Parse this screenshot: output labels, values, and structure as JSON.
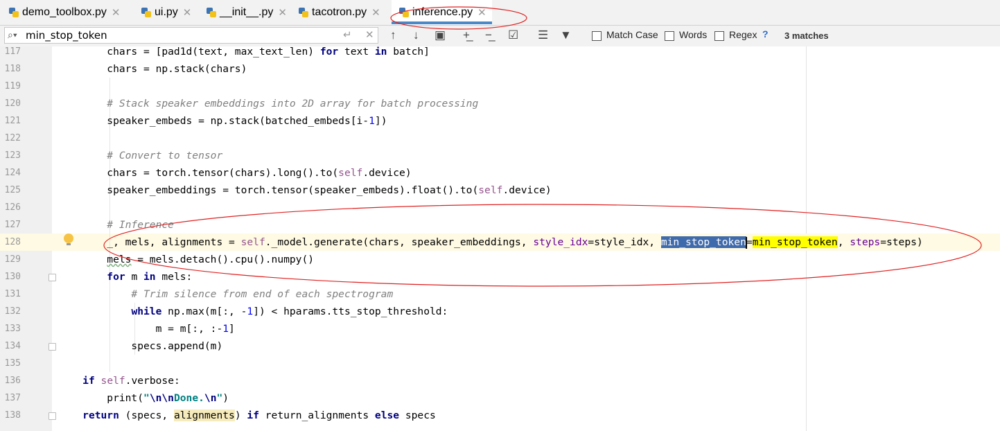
{
  "tabs": [
    {
      "label": "demo_toolbox.py",
      "active": false
    },
    {
      "label": "ui.py",
      "active": false
    },
    {
      "label": "__init__.py",
      "active": false
    },
    {
      "label": "tacotron.py",
      "active": false
    },
    {
      "label": "inference.py",
      "active": true
    }
  ],
  "search": {
    "value": "min_stop_token",
    "options": {
      "match_case": "Match Case",
      "words": "Words",
      "regex": "Regex"
    },
    "help": "?",
    "matches": "3 matches"
  },
  "icons": [
    "search-icon",
    "enter-icon",
    "clear-icon",
    "up-arrow-icon",
    "down-arrow-icon",
    "select-all-icon",
    "add-occurrence-icon",
    "remove-occurrence-icon",
    "select-all-occurrences-icon",
    "filter-lines-icon",
    "filter-icon",
    "bulb-icon"
  ],
  "colors": {
    "selection": "#3f6aab",
    "match": "#ffff00",
    "annotation": "#e02020",
    "tab_underline": "#4a88c7"
  },
  "editor": {
    "line_numbers": [
      "117",
      "118",
      "119",
      "120",
      "121",
      "122",
      "123",
      "124",
      "125",
      "126",
      "127",
      "128",
      "129",
      "130",
      "131",
      "132",
      "133",
      "134",
      "135",
      "136",
      "137",
      "138"
    ],
    "lines": [
      {
        "t": [
          [
            "        chars = [pad1d(text, max_text_len) ",
            ""
          ],
          [
            "for",
            "kw"
          ],
          [
            " text ",
            ""
          ],
          [
            "in",
            "kw"
          ],
          [
            " batch]",
            ""
          ]
        ]
      },
      {
        "t": [
          [
            "        chars = np.stack(chars)",
            ""
          ]
        ]
      },
      {
        "t": []
      },
      {
        "t": [
          [
            "        # Stack speaker embeddings into 2D array for batch processing",
            "cm"
          ]
        ]
      },
      {
        "t": [
          [
            "        speaker_embeds = np.stack(batched_embeds[i-",
            ""
          ],
          [
            "1",
            "num"
          ],
          [
            "])",
            ""
          ]
        ]
      },
      {
        "t": []
      },
      {
        "t": [
          [
            "        # Convert to tensor",
            "cm"
          ]
        ]
      },
      {
        "t": [
          [
            "        chars = torch.tensor(chars).long().to(",
            ""
          ],
          [
            "self",
            "self"
          ],
          [
            ".device)",
            ""
          ]
        ]
      },
      {
        "t": [
          [
            "        speaker_embeddings = torch.tensor(speaker_embeds).float().to(",
            ""
          ],
          [
            "self",
            "self"
          ],
          [
            ".device)",
            ""
          ]
        ]
      },
      {
        "t": []
      },
      {
        "t": [
          [
            "        # Inference",
            "cm"
          ]
        ]
      },
      {
        "t": [
          [
            "        _, mels, alignments = ",
            ""
          ],
          [
            "self",
            "self"
          ],
          [
            "._model.generate(chars, speaker_embeddings, ",
            ""
          ],
          [
            "style_idx",
            "param"
          ],
          [
            "=style_idx, ",
            ""
          ],
          [
            "min_stop_token",
            "sel"
          ],
          [
            "|",
            "caret"
          ],
          [
            "=",
            ""
          ],
          [
            "min_stop_token",
            "hl"
          ],
          [
            ", ",
            ""
          ],
          [
            "steps",
            "param"
          ],
          [
            "=steps)",
            ""
          ]
        ]
      },
      {
        "t": [
          [
            "        ",
            ""
          ],
          [
            "mels",
            "wavy"
          ],
          [
            " = mels.detach().cpu().numpy()",
            ""
          ]
        ]
      },
      {
        "t": [
          [
            "        ",
            ""
          ],
          [
            "for",
            "kw"
          ],
          [
            " m ",
            ""
          ],
          [
            "in",
            "kw"
          ],
          [
            " mels:",
            ""
          ]
        ]
      },
      {
        "t": [
          [
            "            # Trim silence from end of each spectrogram",
            "cm"
          ]
        ]
      },
      {
        "t": [
          [
            "            ",
            ""
          ],
          [
            "while",
            "kw"
          ],
          [
            " np.max(m[:, -",
            ""
          ],
          [
            "1",
            "num"
          ],
          [
            "]) < hparams.tts_stop_threshold:",
            ""
          ]
        ]
      },
      {
        "t": [
          [
            "                m = m[:, :-",
            ""
          ],
          [
            "1",
            "num"
          ],
          [
            "]",
            ""
          ]
        ]
      },
      {
        "t": [
          [
            "            specs.append(m)",
            ""
          ]
        ]
      },
      {
        "t": []
      },
      {
        "t": [
          [
            "    ",
            ""
          ],
          [
            "if",
            "kw"
          ],
          [
            " ",
            ""
          ],
          [
            "self",
            "self"
          ],
          [
            ".verbose:",
            ""
          ]
        ]
      },
      {
        "t": [
          [
            "        print(",
            ""
          ],
          [
            "\"",
            "str"
          ],
          [
            "\\n\\n",
            "esc"
          ],
          [
            "Done.",
            "str"
          ],
          [
            "\\n",
            "esc"
          ],
          [
            "\"",
            "str"
          ],
          [
            ")",
            ""
          ]
        ]
      },
      {
        "t": [
          [
            "    ",
            ""
          ],
          [
            "return",
            "kw"
          ],
          [
            " (specs, ",
            ""
          ],
          [
            "alignments",
            "usage"
          ],
          [
            ") ",
            ""
          ],
          [
            "if",
            "kw"
          ],
          [
            " return_alignments ",
            ""
          ],
          [
            "else",
            "kw"
          ],
          [
            " specs",
            ""
          ]
        ]
      }
    ]
  }
}
